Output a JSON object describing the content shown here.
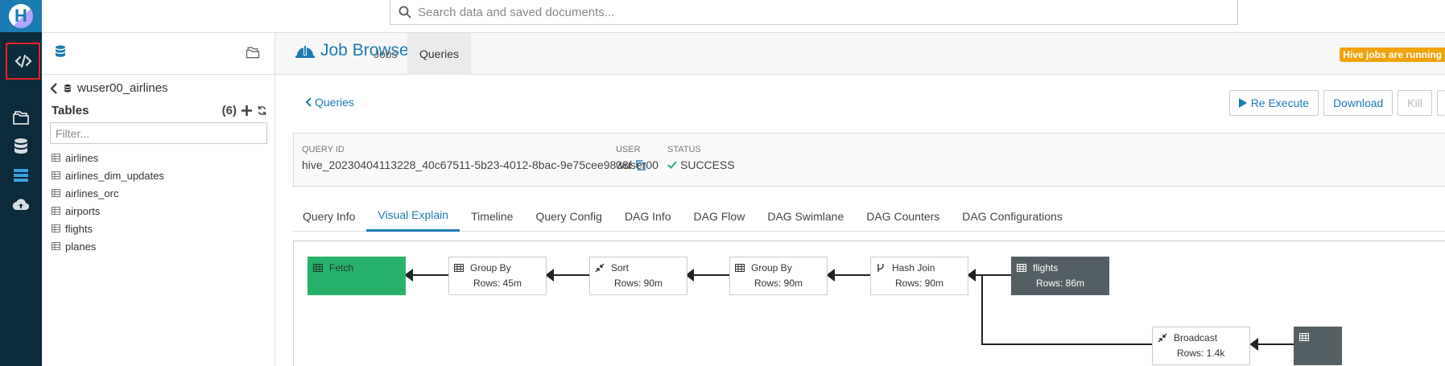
{
  "search": {
    "placeholder": "Search data and saved documents..."
  },
  "assist": {
    "breadcrumb": "wuser00_airlines",
    "tables_label": "Tables",
    "tables_count": "(6)",
    "filter_placeholder": "Filter...",
    "tables": [
      "airlines",
      "airlines_dim_updates",
      "airlines_orc",
      "airports",
      "flights",
      "planes"
    ]
  },
  "header": {
    "title": "Job Browser",
    "tabs": [
      "Jobs",
      "Queries"
    ],
    "active_tab": "Queries",
    "badge": "Hive jobs are running"
  },
  "toolbar": {
    "back": "Queries",
    "re_execute": "Re Execute",
    "download": "Download",
    "kill": "Kill"
  },
  "query": {
    "id_label": "QUERY ID",
    "id": "hive_20230404113228_40c67511-5b23-4012-8bac-9e75cee9838f",
    "user_label": "USER",
    "user": "wuser00",
    "status_label": "STATUS",
    "status": "SUCCESS"
  },
  "detail_tabs": [
    "Query Info",
    "Visual Explain",
    "Timeline",
    "Query Config",
    "DAG Info",
    "DAG Flow",
    "DAG Swimlane",
    "DAG Counters",
    "DAG Configurations"
  ],
  "active_detail_tab": "Visual Explain",
  "plan": {
    "nodes": [
      {
        "title": "Fetch",
        "rows": "",
        "icon": "table-icon",
        "style": "green"
      },
      {
        "title": "Group By",
        "rows": "Rows: 45m",
        "icon": "table-icon",
        "style": "plain"
      },
      {
        "title": "Sort",
        "rows": "Rows: 90m",
        "icon": "compress-icon",
        "style": "plain"
      },
      {
        "title": "Group By",
        "rows": "Rows: 90m",
        "icon": "table-icon",
        "style": "plain"
      },
      {
        "title": "Hash Join",
        "rows": "Rows: 90m",
        "icon": "branch-icon",
        "style": "plain"
      },
      {
        "title": "flights",
        "rows": "Rows: 86m",
        "icon": "table-icon",
        "style": "dark"
      },
      {
        "title": "Broadcast",
        "rows": "Rows: 1.4k",
        "icon": "compress-icon",
        "style": "plain"
      }
    ]
  },
  "colors": {
    "accent": "#1b7bb3",
    "navbar": "#0b2a3b",
    "success": "#27b26b",
    "warning": "#f0a30a",
    "node_dark": "#545f63"
  }
}
